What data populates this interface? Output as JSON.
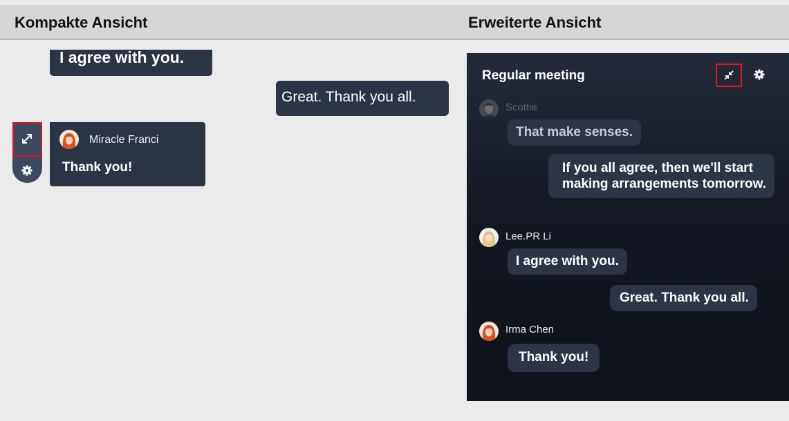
{
  "headers": {
    "compact": "Kompakte Ansicht",
    "expanded": "Erweiterte Ansicht"
  },
  "compact": {
    "bubble_agree": "I agree with you.",
    "bubble_great": "Great. Thank you all.",
    "sender_name": "Miracle Franci",
    "message": "Thank you!"
  },
  "expanded": {
    "title": "Regular meeting",
    "messages": {
      "scottie_name": "Scottie",
      "scottie_text": "That make senses.",
      "self_arrangements": "If you all agree, then we'll start making arrangements tomorrow.",
      "lee_name": "Lee.PR Li",
      "lee_text": "I agree with you.",
      "self_great": "Great. Thank you all.",
      "irma_name": "Irma Chen",
      "irma_text": "Thank you!"
    }
  },
  "icons": [
    "expand-icon",
    "settings-icon",
    "collapse-icon"
  ],
  "colors": {
    "highlight": "#e0141c",
    "panel_bg": "#151b26",
    "bubble_bg": "#2b3546"
  }
}
